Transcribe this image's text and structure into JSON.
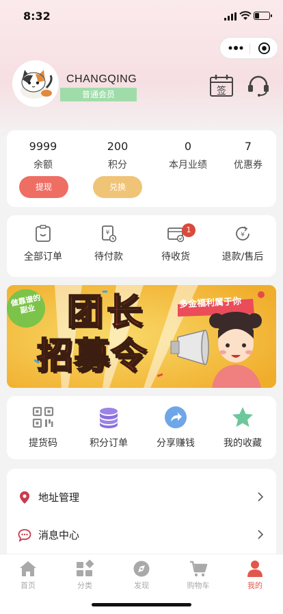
{
  "status_bar": {
    "time": "8:32"
  },
  "profile": {
    "name": "CHANGQING",
    "member_level": "普通会员"
  },
  "stats": [
    {
      "value": "9999",
      "label": "余额"
    },
    {
      "value": "200",
      "label": "积分"
    },
    {
      "value": "0",
      "label": "本月业绩"
    },
    {
      "value": "7",
      "label": "优惠券"
    }
  ],
  "actions": {
    "withdraw": "提现",
    "exchange": "兑换"
  },
  "orders": [
    {
      "label": "全部订单",
      "icon": "clipboard-icon"
    },
    {
      "label": "待付款",
      "icon": "yuan-bill-icon"
    },
    {
      "label": "待收货",
      "icon": "package-check-icon",
      "badge": "1"
    },
    {
      "label": "退款/售后",
      "icon": "refund-icon"
    }
  ],
  "banner": {
    "tag": "做靠谱的副业",
    "title_line1": "团长",
    "title_line2": "招募令",
    "slogan": "多金福利属于你"
  },
  "tools": [
    {
      "label": "提货码",
      "icon": "qr-code-icon",
      "color": "#8a8a8a"
    },
    {
      "label": "积分订单",
      "icon": "coins-stack-icon",
      "color": "#9b84e6"
    },
    {
      "label": "分享赚钱",
      "icon": "share-arrow-icon",
      "color": "#6fa6e8"
    },
    {
      "label": "我的收藏",
      "icon": "star-icon",
      "color": "#6cc79b"
    }
  ],
  "menu": [
    {
      "label": "地址管理",
      "icon": "location-pin-icon"
    },
    {
      "label": "消息中心",
      "icon": "message-bubble-icon"
    }
  ],
  "tabbar": [
    {
      "label": "首页",
      "icon": "home-icon"
    },
    {
      "label": "分类",
      "icon": "category-icon"
    },
    {
      "label": "发现",
      "icon": "compass-icon"
    },
    {
      "label": "购物车",
      "icon": "cart-icon"
    },
    {
      "label": "我的",
      "icon": "person-icon",
      "active": true
    }
  ],
  "colors": {
    "accent": "#e2574c",
    "withdraw": "#ee6e63",
    "exchange": "#f0c477",
    "member_badge": "#9fdcaa"
  }
}
